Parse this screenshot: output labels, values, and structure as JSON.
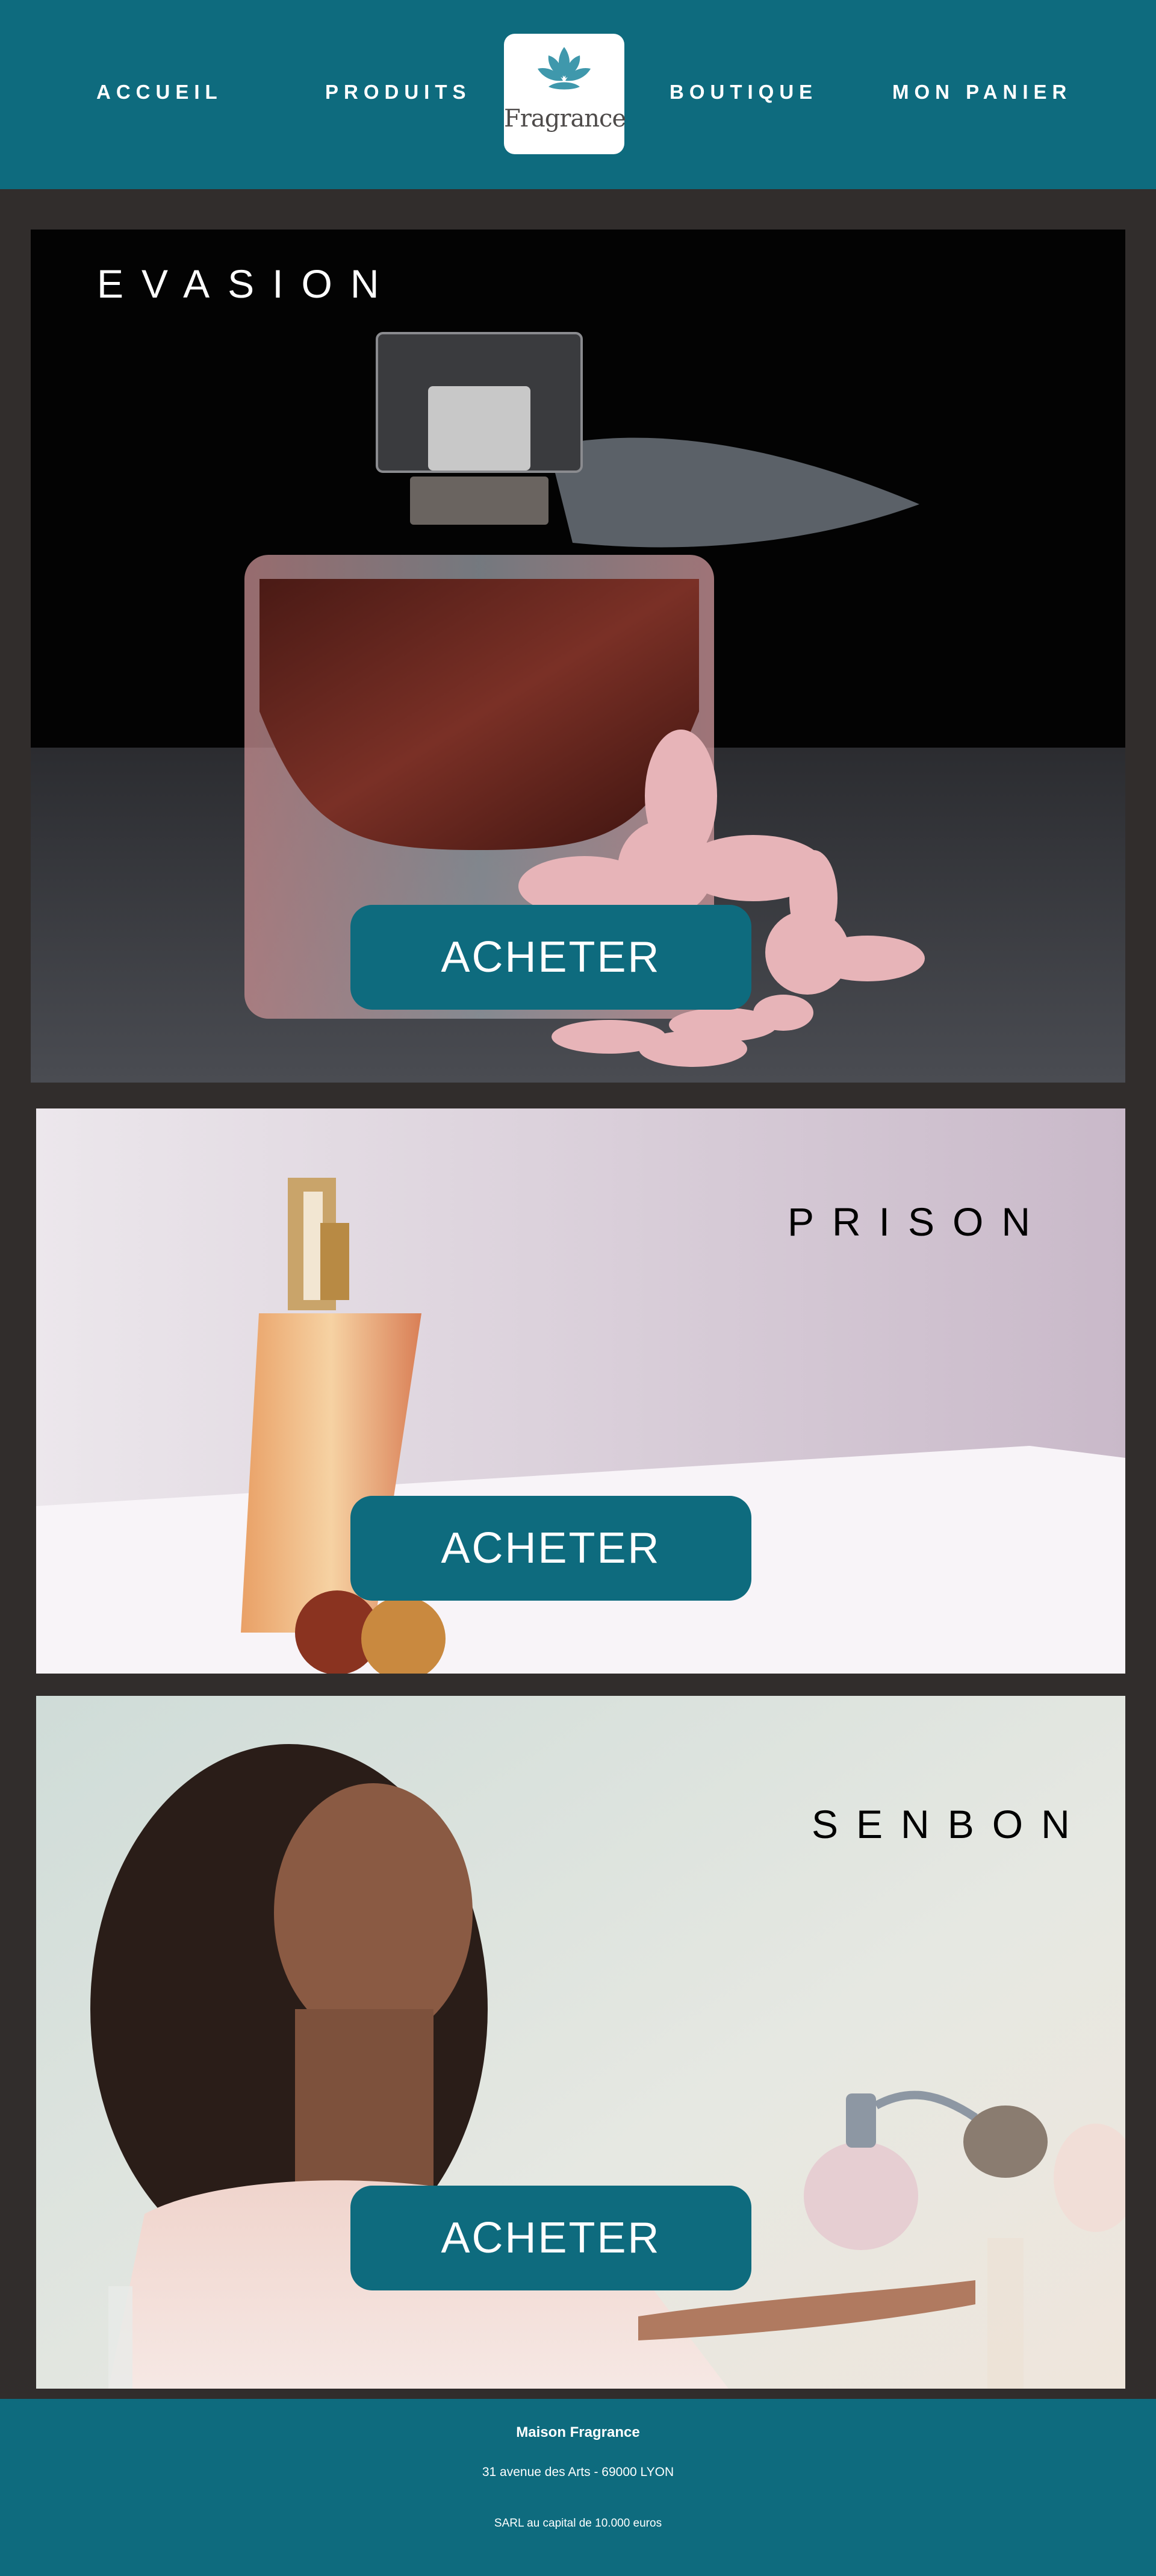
{
  "nav": {
    "left": [
      "ACCUEIL",
      "PRODUITS"
    ],
    "right": [
      "BOUTIQUE",
      "MON PANIER"
    ],
    "logo_text": "Fragrance"
  },
  "products": [
    {
      "name": "EVASION",
      "button": "ACHETER"
    },
    {
      "name": "PRISON",
      "button": "ACHETER"
    },
    {
      "name": "SENBON",
      "button": "ACHETER"
    }
  ],
  "footer": {
    "company": "Maison Fragrance",
    "address": "31 avenue des Arts - 69000 LYON",
    "capital": "SARL au capital de 10.000 euros"
  },
  "colors": {
    "brand": "#0e6b7e",
    "background": "#312d2c",
    "logo_accent": "#3f98ac"
  },
  "icons": {
    "logo": "lotus-icon"
  }
}
